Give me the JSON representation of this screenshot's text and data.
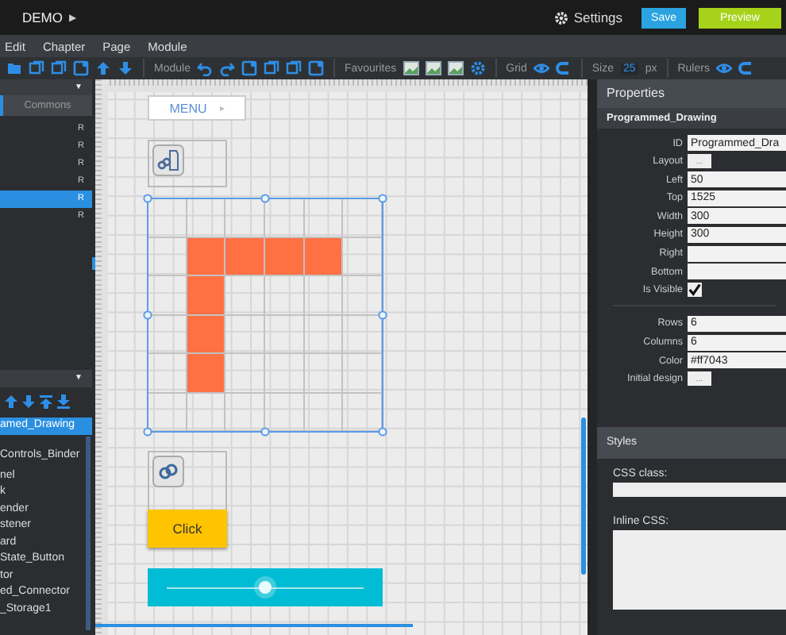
{
  "top_bar": {
    "title": "DEMO",
    "title_arrow": "▶",
    "settings": "Settings",
    "save": "Save",
    "preview": "Preview"
  },
  "menu": [
    "Edit",
    "Chapter",
    "Page",
    "Module"
  ],
  "toolbar": {
    "module": "Module",
    "favourites": "Favourites",
    "grid": "Grid",
    "size_label": "Size",
    "size_value": "25",
    "size_unit": "px",
    "rulers": "Rulers"
  },
  "left_panel": {
    "header_caret": "▼",
    "tabs": [
      {
        "selected": true
      },
      {
        "label": "Commons",
        "selected": false
      }
    ],
    "items": [
      {
        "badge": "R",
        "selected": false
      },
      {
        "badge": "R",
        "selected": false
      },
      {
        "badge": "R",
        "selected": false
      },
      {
        "badge": "R",
        "selected": false
      },
      {
        "badge": "R",
        "selected": true
      },
      {
        "badge": "R",
        "selected": false
      }
    ],
    "tree_caret": "▼",
    "tree": [
      {
        "label": "amed_Drawing",
        "selected": true
      },
      {
        "label": "Controls_Binder",
        "selected": false
      },
      {
        "label": "nel",
        "selected": false
      },
      {
        "label": "k",
        "selected": false
      },
      {
        "label": "ender",
        "selected": false
      },
      {
        "label": "stener",
        "selected": false
      },
      {
        "label": "ard",
        "selected": false
      },
      {
        "label": "State_Button",
        "selected": false
      },
      {
        "label": "tor",
        "selected": false
      },
      {
        "label": "ed_Connector",
        "selected": false
      },
      {
        "label": "_Storage1",
        "selected": false
      }
    ]
  },
  "canvas": {
    "menu_button": {
      "label": "MENU",
      "arrow": "▸"
    },
    "drawing": {
      "selected": true,
      "color": "#ff7043",
      "cells": [
        [
          false,
          false,
          false,
          false,
          false,
          false
        ],
        [
          false,
          true,
          true,
          true,
          true,
          false
        ],
        [
          false,
          true,
          false,
          false,
          false,
          false
        ],
        [
          false,
          true,
          false,
          false,
          false,
          false
        ],
        [
          false,
          true,
          false,
          false,
          false,
          false
        ],
        [
          false,
          false,
          false,
          false,
          false,
          false
        ]
      ]
    },
    "click_button": "Click",
    "slider": {
      "level": 0.5
    }
  },
  "properties": {
    "title": "Properties",
    "element": "Programmed_Drawing",
    "fields": [
      {
        "label": "ID",
        "kind": "text",
        "value": "Programmed_Dra"
      },
      {
        "label": "Layout",
        "kind": "button",
        "value": "..."
      },
      {
        "label": "Left",
        "kind": "text",
        "value": "50"
      },
      {
        "label": "Top",
        "kind": "text",
        "value": "1525"
      },
      {
        "label": "Width",
        "kind": "text",
        "value": "300"
      },
      {
        "label": "Height",
        "kind": "text",
        "value": "300"
      },
      {
        "label": "Right",
        "kind": "text"
      },
      {
        "label": "Bottom",
        "kind": "text"
      },
      {
        "label": "Is Visible",
        "kind": "checkbox",
        "checked": true
      }
    ],
    "grid_fields": [
      {
        "label": "Rows",
        "kind": "text",
        "value": "6"
      },
      {
        "label": "Columns",
        "kind": "text",
        "value": "6"
      },
      {
        "label": "Color",
        "kind": "text",
        "value": "#ff7043"
      },
      {
        "label": "Initial design",
        "kind": "button",
        "value": "..."
      }
    ]
  },
  "styles": {
    "title": "Styles",
    "css_class_label": "CSS class:",
    "inline_css_label": "Inline CSS:"
  }
}
